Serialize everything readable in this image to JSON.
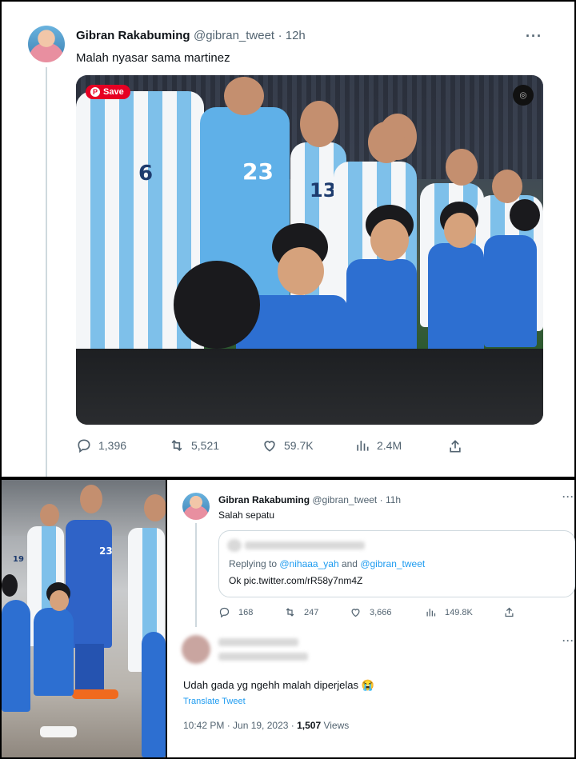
{
  "tweet_main": {
    "name": "Gibran Rakabuming",
    "handle": "@gibran_tweet",
    "time": "· 12h",
    "text": "Malah nyasar sama martinez",
    "more": "···",
    "save_badge": "Save",
    "jersey_numbers": [
      "6",
      "23",
      "13"
    ],
    "actions": {
      "replies": "1,396",
      "retweets": "5,521",
      "likes": "59.7K",
      "views": "2.4M"
    }
  },
  "tweet_reply": {
    "name": "Gibran Rakabuming",
    "handle": "@gibran_tweet",
    "time": "· 11h",
    "text": "Salah sepatu",
    "more": "···",
    "quote": {
      "replying_prefix": "Replying to ",
      "replying_user1": "@nihaaa_yah",
      "replying_and": " and ",
      "replying_user2": "@gibran_tweet",
      "body_prefix": "Ok ",
      "body_link": "pic.twitter.com/rR58y7nm4Z"
    },
    "actions": {
      "replies": "168",
      "retweets": "247",
      "likes": "3,666",
      "views": "149.8K"
    }
  },
  "tweet_comment": {
    "text": "Udah gada yg ngehh malah diperjelas 😭",
    "translate": "Translate Tweet",
    "timestamp": "10:42 PM · Jun 19, 2023 · ",
    "views_count": "1,507",
    "views_label": " Views",
    "more": "···"
  },
  "side_photo": {
    "jersey_numbers": [
      "23",
      "19"
    ]
  },
  "colors": {
    "accent": "#1d9bf0",
    "muted": "#536471",
    "pinterest": "#e60023",
    "kid_kit": "#2d6fd1"
  }
}
